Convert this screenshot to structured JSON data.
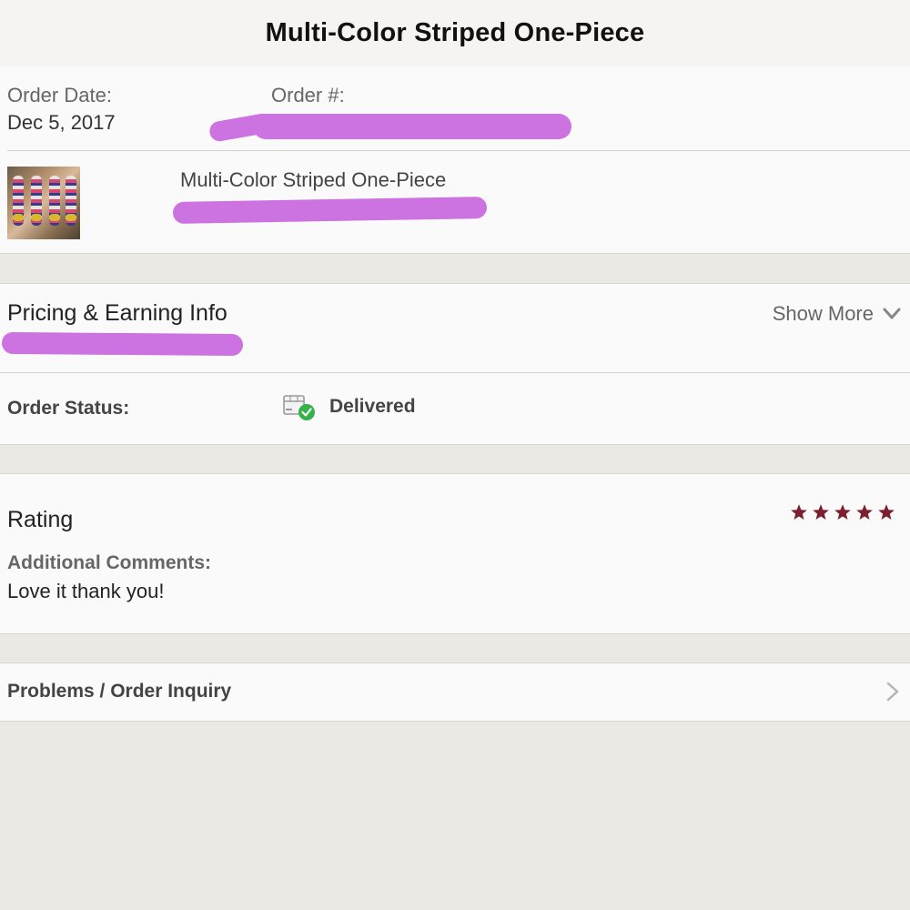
{
  "header": {
    "title": "Multi-Color Striped One-Piece"
  },
  "order": {
    "date_label": "Order Date:",
    "date_value": "Dec 5, 2017",
    "number_label": "Order #:",
    "item_name": "Multi-Color Striped One-Piece"
  },
  "pricing": {
    "title": "Pricing & Earning Info",
    "show_more_label": "Show More"
  },
  "status": {
    "label": "Order Status:",
    "value": "Delivered",
    "icon": "delivered-box-check-icon",
    "check_color": "#35b34a"
  },
  "rating": {
    "title": "Rating",
    "stars": 5,
    "star_color": "#7b2030",
    "comments_label": "Additional Comments:",
    "comments_text": "Love it thank you!"
  },
  "problems": {
    "label": "Problems / Order Inquiry"
  },
  "colors": {
    "redaction": "#cc73e1",
    "background": "#ebe9e4",
    "panel": "#fbfafb"
  }
}
